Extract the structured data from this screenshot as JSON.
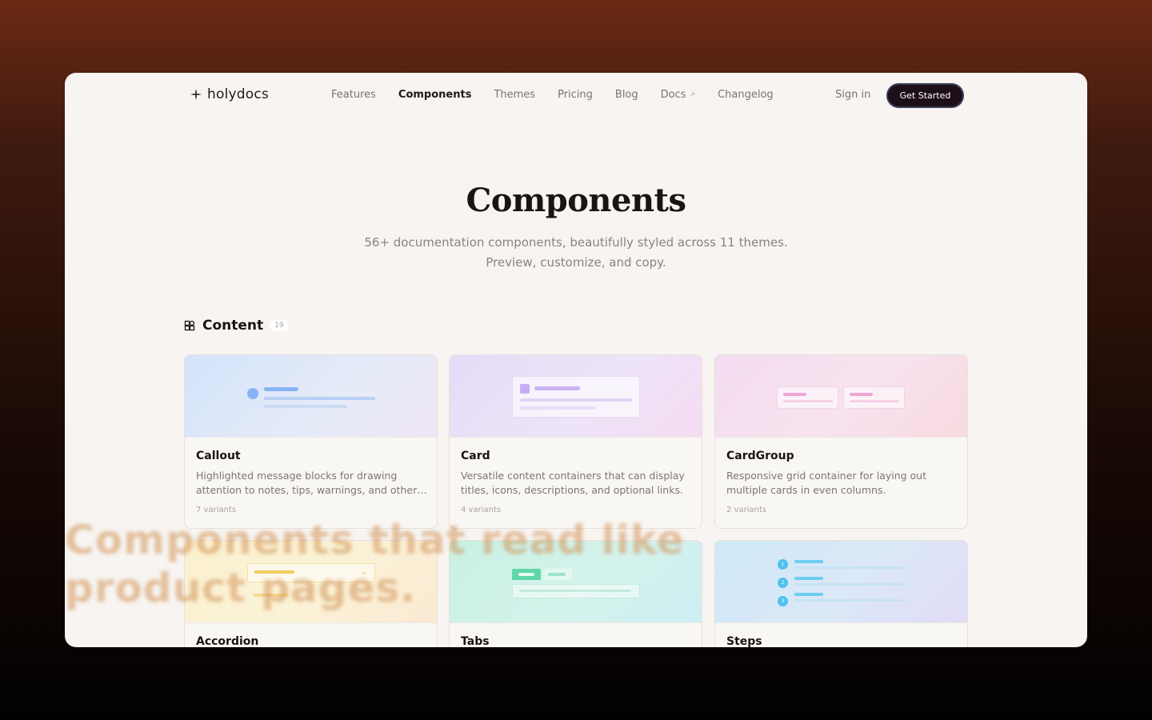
{
  "logo": {
    "text": "holydocs",
    "icon": "sparkle-icon"
  },
  "nav": {
    "links": [
      {
        "label": "Features",
        "active": false
      },
      {
        "label": "Components",
        "active": true
      },
      {
        "label": "Themes",
        "active": false
      },
      {
        "label": "Pricing",
        "active": false
      },
      {
        "label": "Blog",
        "active": false
      },
      {
        "label": "Docs",
        "active": false,
        "external": true,
        "external_glyph": "↗"
      },
      {
        "label": "Changelog",
        "active": false
      }
    ],
    "sign_in": "Sign in",
    "cta": "Get Started"
  },
  "hero": {
    "title": "Components",
    "subtitle_line1": "56+ documentation components, beautifully styled across 11 themes.",
    "subtitle_line2": "Preview, customize, and copy."
  },
  "section": {
    "title": "Content",
    "count": "19",
    "icon": "components-icon"
  },
  "cards": [
    {
      "title": "Callout",
      "description": "Highlighted message blocks for drawing attention to notes, tips, warnings, and other important information.",
      "variants": "7 variants"
    },
    {
      "title": "Card",
      "description": "Versatile content containers that can display titles, icons, descriptions, and optional links.",
      "variants": "4 variants"
    },
    {
      "title": "CardGroup",
      "description": "Responsive grid container for laying out multiple cards in even columns.",
      "variants": "2 variants"
    },
    {
      "title": "Accordion"
    },
    {
      "title": "Tabs"
    },
    {
      "title": "Steps",
      "steps": [
        "1",
        "2",
        "3"
      ]
    }
  ],
  "overlay": {
    "line1": "Components that read like",
    "line2": "product pages."
  }
}
